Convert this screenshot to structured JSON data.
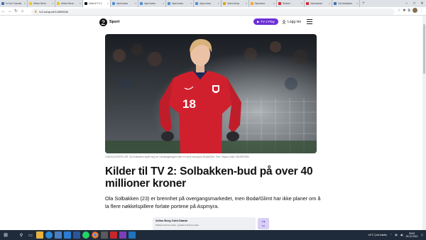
{
  "browser": {
    "tabs": [
      {
        "title": "En Son Transfer",
        "color": "#3b6fb6"
      },
      {
        "title": "Yellow Nerve",
        "color": "#f0c419"
      },
      {
        "title": "Yellow Nerve",
        "color": "#f0c419"
      },
      {
        "title": "Kilder til TV 2",
        "color": "#111111",
        "active": true
      },
      {
        "title": "https://www",
        "color": "#4a90d9"
      },
      {
        "title": "https://www",
        "color": "#4a90d9"
      },
      {
        "title": "https://www",
        "color": "#4a90d9"
      },
      {
        "title": "https://www",
        "color": "#4a90d9"
      },
      {
        "title": "Dnevni Avaz",
        "color": "#e0a400"
      },
      {
        "title": "Barcelona",
        "color": "#f5a623"
      },
      {
        "title": "Reuters",
        "color": "#e0242f"
      },
      {
        "title": "Dokumentar",
        "color": "#e0242f"
      },
      {
        "title": "Ola Solbakken",
        "color": "#3b6fb6"
      }
    ],
    "url": "tv2.no/sport/14455516/",
    "new_tab": "+",
    "close_tab": "×"
  },
  "site": {
    "section": "Sport",
    "play_button": "TV 2 Play",
    "login": "Logg inn"
  },
  "article": {
    "caption": "LANDSLAGSSPILLER: Ola Solbakken spiller seg inn i landslagstroppen etter en sterk sesong for Bodø/Glimt. Foto: Vegard Grøtt / BILDBYRÅN",
    "headline": "Kilder til TV 2: Solbakken-bud på over 40 millioner kroner",
    "lede": "Ola Solbakken (23) er brennhet på overgangsmarkedet, men Bodø/Glimt har ikke planer om å la flere nøkkelspillere forlate portene på Aspmyra.",
    "player_number": "18"
  },
  "card": {
    "title": "Arilas Borg Ould-Saada",
    "subtitle": "Publisert 10 timer siden, oppdatert 10 timer siden",
    "button_label": "Del"
  },
  "taskbar": {
    "weather": "14°C  Çok bulutlu",
    "time": "09:52",
    "date": "03.12.2021"
  }
}
